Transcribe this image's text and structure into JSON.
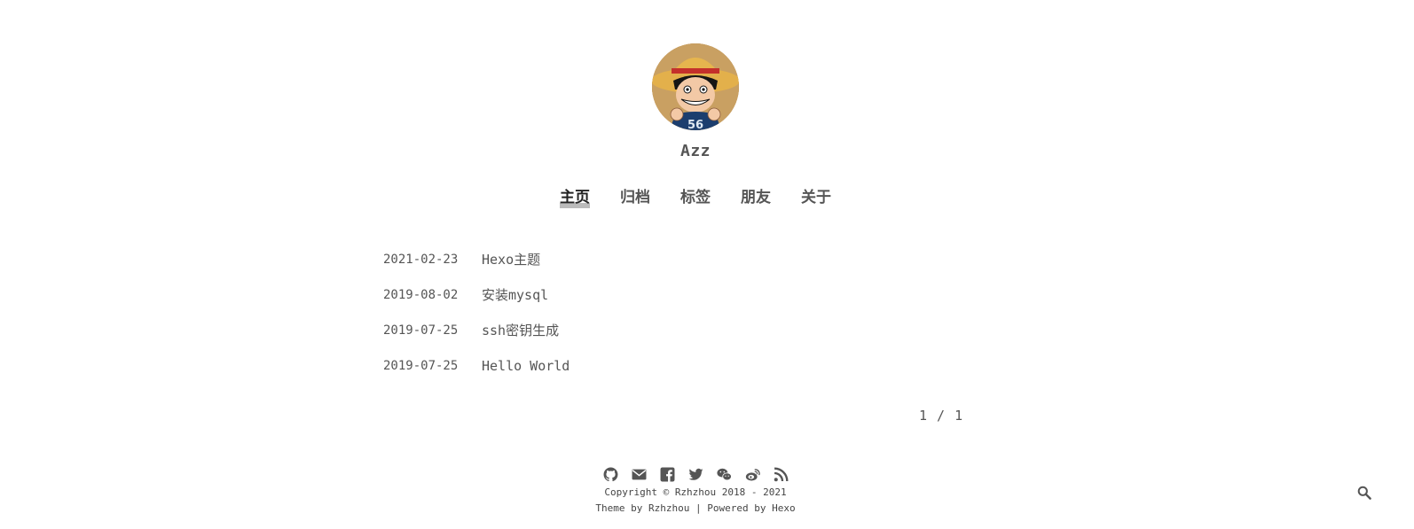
{
  "site": {
    "name": "Azz"
  },
  "nav": {
    "items": [
      {
        "label": "主页",
        "active": true
      },
      {
        "label": "归档",
        "active": false
      },
      {
        "label": "标签",
        "active": false
      },
      {
        "label": "朋友",
        "active": false
      },
      {
        "label": "关于",
        "active": false
      }
    ]
  },
  "posts": [
    {
      "date": "2021-02-23",
      "title": "Hexo主题"
    },
    {
      "date": "2019-08-02",
      "title": "安装mysql"
    },
    {
      "date": "2019-07-25",
      "title": "ssh密钥生成"
    },
    {
      "date": "2019-07-25",
      "title": "Hello World"
    }
  ],
  "pagination": {
    "text": "1 / 1"
  },
  "footer": {
    "social_icons": [
      "github-icon",
      "mail-icon",
      "facebook-icon",
      "twitter-icon",
      "wechat-icon",
      "weibo-icon",
      "rss-icon"
    ],
    "copyright": "Copyright © Rzhzhou 2018 - 2021",
    "theme_prefix": "Theme by",
    "theme_author": "Rzhzhou",
    "separator": "|",
    "powered_prefix": "Powered by",
    "powered_name": "Hexo"
  },
  "colors": {
    "text": "#555555",
    "active_underline": "#bbbbbb",
    "background": "#ffffff"
  }
}
